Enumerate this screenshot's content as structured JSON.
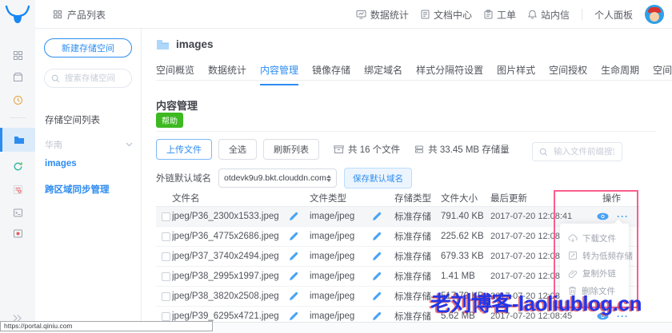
{
  "colors": {
    "accent": "#2d8cf0",
    "help_green": "#3db922",
    "annotation_pink": "#fb5e8e",
    "watermark_blue": "#2336e8"
  },
  "topbar": {
    "product_list": "产品列表",
    "nav_items": [
      {
        "label": "数据统计",
        "icon": "stats-icon"
      },
      {
        "label": "文档中心",
        "icon": "docs-icon"
      },
      {
        "label": "工单",
        "icon": "ticket-icon"
      },
      {
        "label": "站内信",
        "icon": "mail-icon"
      }
    ],
    "personal_panel": "个人面板"
  },
  "icon_rail": {
    "items": [
      {
        "icon": "grid-icon",
        "active": false
      },
      {
        "icon": "deploy-icon",
        "active": false
      },
      {
        "icon": "clock-icon",
        "active": false
      },
      {
        "icon": "storage-icon",
        "active": true
      },
      {
        "icon": "sync-icon",
        "active": false
      },
      {
        "icon": "cert-icon",
        "active": false
      },
      {
        "icon": "terminal-icon",
        "active": false
      },
      {
        "icon": "media-icon",
        "active": false
      },
      {
        "icon": "collapse-icon",
        "active": false
      }
    ]
  },
  "sidebar": {
    "new_bucket_button": "新建存储空间",
    "search_placeholder": "搜索存储空间",
    "list_title": "存储空间列表",
    "region_selected": "华南",
    "bucket_active": "images",
    "cross_region_link": "跨区域同步管理"
  },
  "main": {
    "bucket_title": "images",
    "tabs": [
      {
        "label": "空间概览",
        "active": false
      },
      {
        "label": "数据统计",
        "active": false
      },
      {
        "label": "内容管理",
        "active": true
      },
      {
        "label": "镜像存储",
        "active": false
      },
      {
        "label": "绑定域名",
        "active": false
      },
      {
        "label": "样式分隔符设置",
        "active": false
      },
      {
        "label": "图片样式",
        "active": false
      },
      {
        "label": "空间授权",
        "active": false
      },
      {
        "label": "生命周期",
        "active": false
      },
      {
        "label": "空间设置",
        "active": false
      }
    ],
    "section": {
      "title": "内容管理",
      "help_badge": "帮助"
    },
    "toolbar": {
      "upload_button": "上传文件",
      "select_all_button": "全选",
      "refresh_button": "刷新列表",
      "files_count": "共 16 个文件",
      "storage_total": "共 33.45 MB 存储量",
      "search_placeholder": "输入文件前缀搜索"
    },
    "domain_row": {
      "label": "外链默认域名",
      "selected_domain": "otdevk9u9.bkt.clouddn.com",
      "save_button": "保存默认域名"
    },
    "table": {
      "headers": [
        "文件名",
        "文件类型",
        "存储类型",
        "文件大小",
        "最后更新",
        "操作"
      ],
      "rows": [
        {
          "name": "jpeg/P36_2300x1533.jpeg",
          "type": "image/jpeg",
          "storage": "标准存储",
          "size": "791.40 KB",
          "updated": "2017-07-20 12:08:41",
          "highlighted": true,
          "show_ops": true
        },
        {
          "name": "jpeg/P36_4775x2686.jpeg",
          "type": "image/jpeg",
          "storage": "标准存储",
          "size": "225.62 KB",
          "updated": "2017-07-20 12:08:41",
          "highlighted": false,
          "show_ops": false
        },
        {
          "name": "jpeg/P37_3740x2494.jpeg",
          "type": "image/jpeg",
          "storage": "标准存储",
          "size": "679.33 KB",
          "updated": "2017-07-20 12:08:41",
          "highlighted": false,
          "show_ops": false
        },
        {
          "name": "jpeg/P38_2995x1997.jpeg",
          "type": "image/jpeg",
          "storage": "标准存储",
          "size": "1.41 MB",
          "updated": "2017-07-20 12:08:43",
          "highlighted": false,
          "show_ops": false
        },
        {
          "name": "jpeg/P38_3820x2508.jpeg",
          "type": "image/jpeg",
          "storage": "标准存储",
          "size": "517.79 KB",
          "updated": "2017-07-20 12:08:41",
          "highlighted": false,
          "show_ops": false
        },
        {
          "name": "jpeg/P39_6295x4721.jpeg",
          "type": "image/jpeg",
          "storage": "标准存储",
          "size": "5.62 MB",
          "updated": "2017-07-20 12:08:45",
          "highlighted": false,
          "show_ops": true
        }
      ]
    },
    "context_menu": {
      "items": [
        {
          "label": "下载文件",
          "icon": "cloud-download-icon"
        },
        {
          "label": "转为低频存储",
          "icon": "convert-storage-icon"
        },
        {
          "label": "复制外链",
          "icon": "link-icon"
        },
        {
          "label": "删除文件",
          "icon": "trash-icon"
        }
      ]
    }
  },
  "overlay": {
    "watermark": "老刘博客-laoliublog.cn",
    "status_url": "https://portal.qiniu.com"
  }
}
